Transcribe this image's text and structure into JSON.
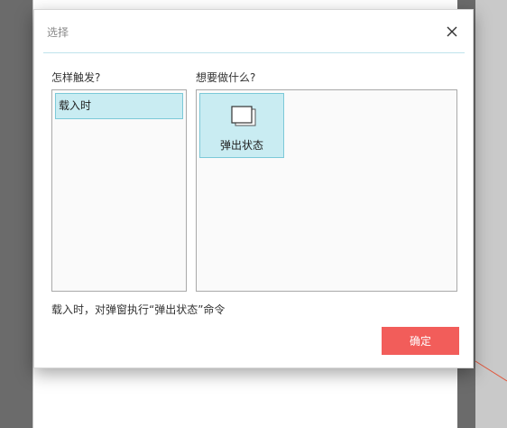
{
  "dialog": {
    "title": "选择",
    "trigger_label": "怎样触发?",
    "action_label": "想要做什么?",
    "triggers": [
      {
        "label": "载入时",
        "selected": true
      }
    ],
    "actions": [
      {
        "label": "弹出状态",
        "icon": "popup-layers-icon",
        "selected": true
      }
    ],
    "summary": "载入时，对弹窗执行“弹出状态”命令",
    "confirm_label": "确定"
  },
  "colors": {
    "accent": "#f25d5a",
    "selection_bg": "#c9ecf2",
    "selection_border": "#7cc9d8"
  }
}
